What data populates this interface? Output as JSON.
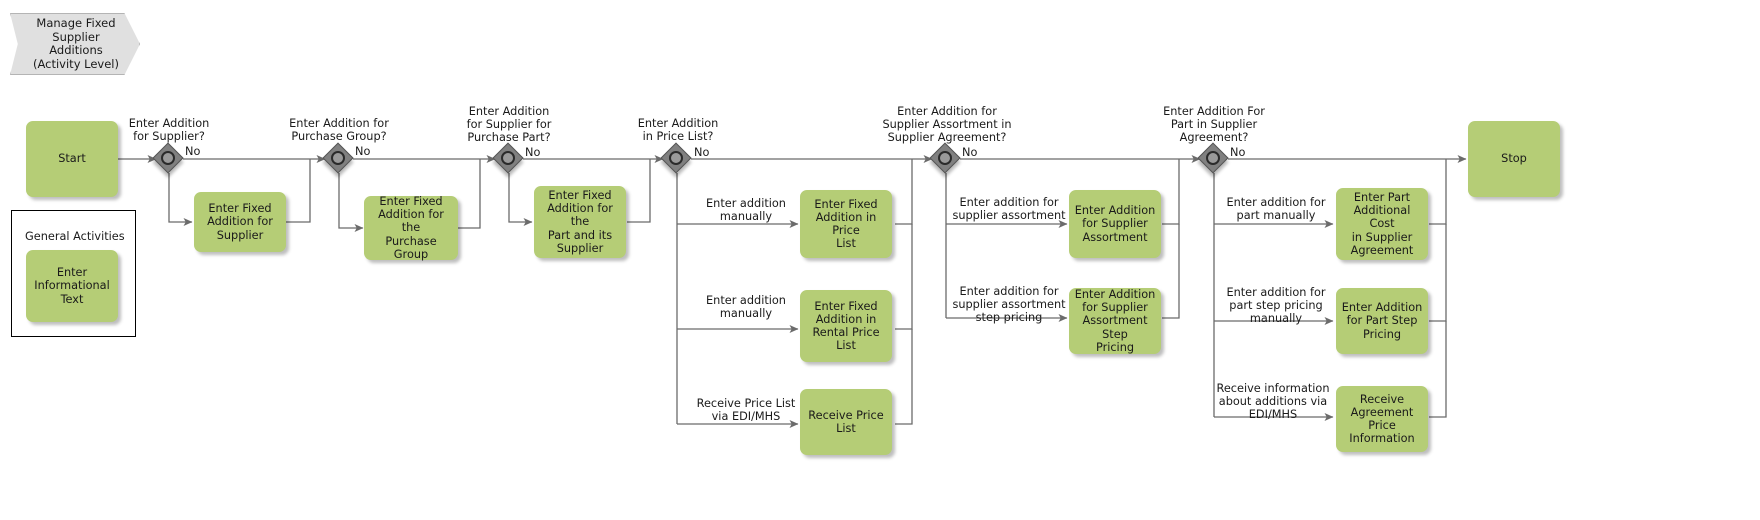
{
  "diagram": {
    "title": "Manage Fixed\nSupplier\nAdditions\n(Activity Level)",
    "colors": {
      "activity_fill": "#b5cd76",
      "banner_fill": "#e0e0e0",
      "gateway_fill": "#808080",
      "line": "#606060"
    }
  },
  "nodes": {
    "start": "Start",
    "stop": "Stop",
    "general_activities_title": "General Activities",
    "informational_text": "Enter\nInformational\nText",
    "fixed_addition_supplier": "Enter Fixed\nAddition for\nSupplier",
    "fixed_addition_purchase_group": "Enter Fixed\nAddition for the\nPurchase Group",
    "fixed_addition_part_supplier": "Enter Fixed\nAddition for the\nPart and its\nSupplier",
    "fixed_addition_price_list": "Enter Fixed\nAddition in Price\nList",
    "fixed_addition_rental_price_list": "Enter Fixed\nAddition in\nRental Price List",
    "receive_price_list": "Receive Price\nList",
    "addition_supplier_assortment": "Enter Addition\nfor Supplier\nAssortment",
    "addition_supplier_assortment_step_pricing": "Enter Addition\nfor Supplier\nAssortment Step\nPricing",
    "part_additional_cost": "Enter Part\nAdditional Cost\nin Supplier\nAgreement",
    "addition_part_step_pricing": "Enter Addition\nfor Part Step\nPricing",
    "receive_agreement_price_info": "Receive\nAgreement Price\nInformation"
  },
  "gateways": [
    {
      "id": "gw-supplier",
      "question": "Enter Addition\nfor Supplier?",
      "no_label": "No"
    },
    {
      "id": "gw-purchase-group",
      "question": "Enter Addition for\nPurchase Group?",
      "no_label": "No"
    },
    {
      "id": "gw-purchase-part",
      "question": "Enter Addition\nfor Supplier for\nPurchase Part?",
      "no_label": "No"
    },
    {
      "id": "gw-price-list",
      "question": "Enter Addition\nin Price List?",
      "no_label": "No"
    },
    {
      "id": "gw-supplier-assortment",
      "question": "Enter Addition for\nSupplier Assortment in\nSupplier Agreement?",
      "no_label": "No"
    },
    {
      "id": "gw-part-agreement",
      "question": "Enter Addition For\nPart in Supplier\nAgreement?",
      "no_label": "No"
    }
  ],
  "edge_labels": {
    "price_list_manual_1": "Enter addition\nmanually",
    "price_list_manual_2": "Enter addition\nmanually",
    "price_list_edi": "Receive Price List\nvia EDI/MHS",
    "assortment_manual": "Enter addition for\nsupplier assortment",
    "assortment_step_pricing": "Enter addition for\nsupplier assortment\nstep pricing",
    "part_manual": "Enter addition for\npart manually",
    "part_step_pricing_manual": "Enter addition for\npart step pricing\nmanually",
    "part_edi": "Receive information\nabout additions via\nEDI/MHS"
  }
}
